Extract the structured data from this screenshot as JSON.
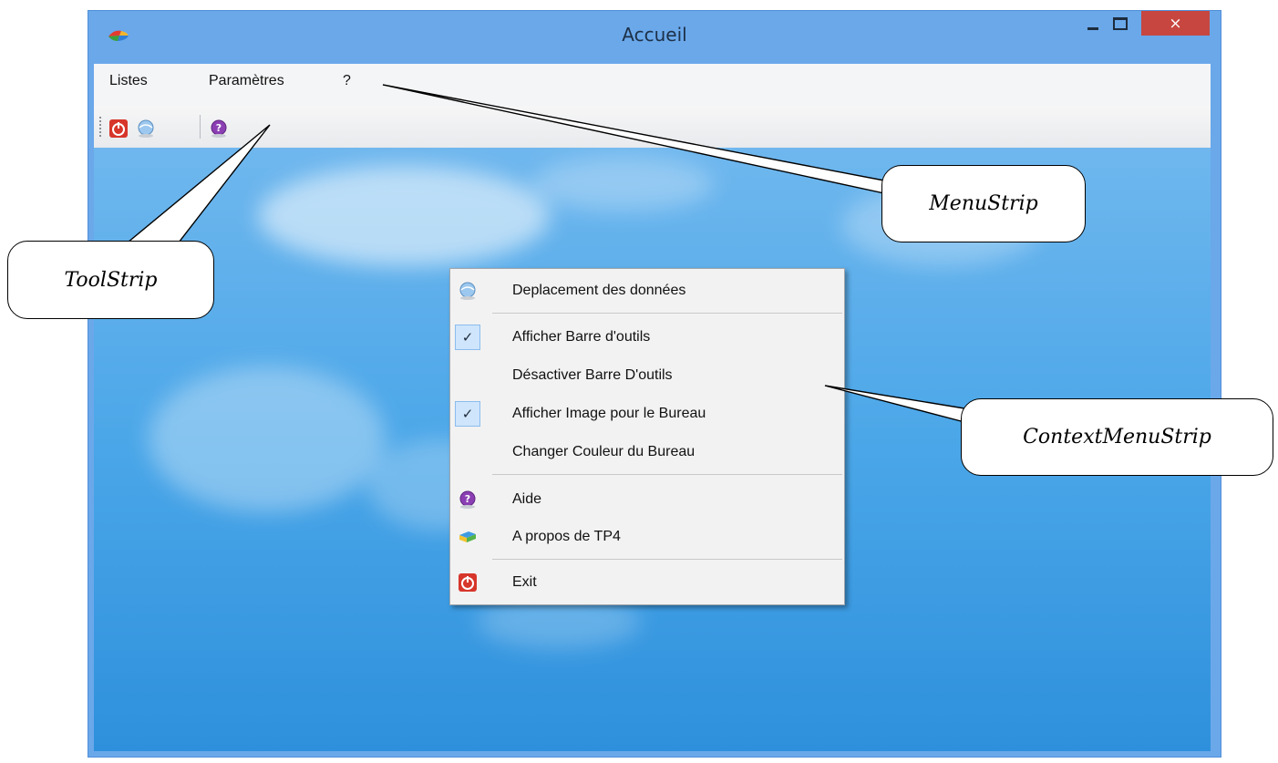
{
  "window": {
    "title": "Accueil",
    "close_glyph": "×",
    "icons": {
      "app": "app-logo-icon",
      "minimize": "minimize-icon",
      "maximize": "maximize-icon",
      "close": "close-icon"
    }
  },
  "menubar": {
    "items": [
      {
        "label": "Listes"
      },
      {
        "label": "Paramètres"
      },
      {
        "label": "?"
      }
    ]
  },
  "toolbar": {
    "buttons": [
      {
        "icon": "exit-icon"
      },
      {
        "icon": "globe-icon"
      },
      {
        "icon": "help-icon"
      }
    ]
  },
  "context_menu": {
    "items": [
      {
        "label": "Deplacement des données",
        "icon": "globe-icon",
        "checked": false
      },
      {
        "label": "Afficher Barre d'outils",
        "checked": true
      },
      {
        "label": "Désactiver Barre D'outils",
        "checked": false
      },
      {
        "label": "Afficher Image pour le Bureau",
        "checked": true
      },
      {
        "label": "Changer Couleur du Bureau",
        "checked": false
      },
      {
        "label": "Aide",
        "icon": "help-icon"
      },
      {
        "label": "A propos de TP4",
        "icon": "about-icon"
      },
      {
        "label": "Exit",
        "icon": "exit-icon"
      }
    ],
    "check_glyph": "✓"
  },
  "annotations": {
    "menustrip": "MenuStrip",
    "toolstrip": "ToolStrip",
    "contextmenustrip": "ContextMenuStrip"
  },
  "colors": {
    "titlebar": "#6aa8ea",
    "close_button": "#c7463f",
    "desktop": "#4aa6e8",
    "check_highlight": "#cfe5fb"
  }
}
